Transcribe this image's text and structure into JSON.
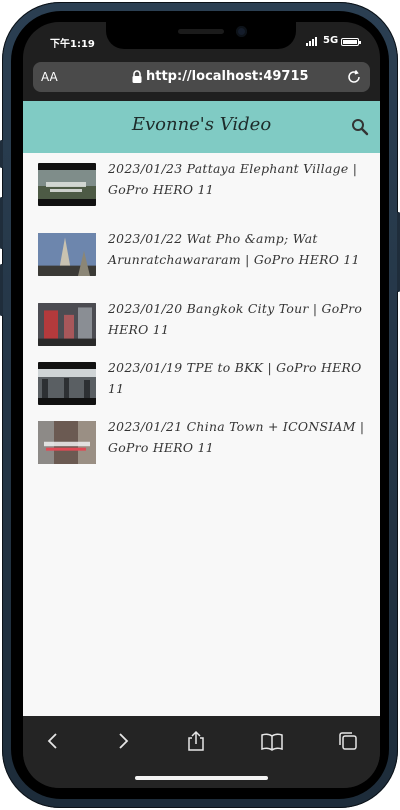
{
  "status_bar": {
    "time": "下午1:19",
    "network": "5G"
  },
  "browser": {
    "text_size_label": "AA",
    "url": "http://localhost:49715"
  },
  "app": {
    "title": "Evonne's Video"
  },
  "videos": [
    {
      "title": "2023/01/23 Pattaya Elephant Village | GoPro HERO 11",
      "thumb_color": "#7f8d8a"
    },
    {
      "title": "2023/01/22 Wat Pho &amp; Wat Arunratchawararam | GoPro HERO 11",
      "thumb_color": "#5f6f86"
    },
    {
      "title": "2023/01/20 Bangkok City Tour | GoPro HERO 11",
      "thumb_color": "#7c4a48"
    },
    {
      "title": "2023/01/19 TPE to BKK | GoPro HERO 11",
      "thumb_color": "#5a5f63"
    },
    {
      "title": "2023/01/21 China Town + ICONSIAM | GoPro HERO 11",
      "thumb_color": "#6b5a52"
    }
  ],
  "colors": {
    "app_bar": "#80cbc4",
    "content_background": "#f8f8f8",
    "toolbar": "#242424",
    "phone_frame": "#2b3f52"
  },
  "toolbar_icons": [
    "back-icon",
    "forward-icon",
    "share-icon",
    "bookmarks-icon",
    "tabs-icon"
  ]
}
